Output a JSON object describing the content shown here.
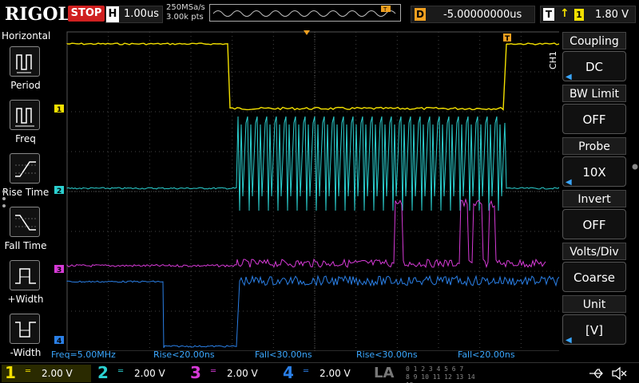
{
  "brand": "RIGOL",
  "run_state": "STOP",
  "timebase": {
    "tag": "H",
    "value": "1.00us"
  },
  "sample": {
    "rate": "250MSa/s",
    "points": "3.00k pts"
  },
  "delay": {
    "tag": "D",
    "value": "-5.00000000us"
  },
  "trigger": {
    "tag": "T",
    "edge": "rising",
    "source": "1",
    "level": "1.80 V"
  },
  "horizontal_menu": {
    "title": "Horizontal",
    "items": [
      "Period",
      "Freq",
      "Rise Time",
      "Fall Time",
      "+Width",
      "-Width"
    ]
  },
  "ch1_menu": {
    "side_label": "CH1",
    "items": [
      {
        "title": "Coupling",
        "value": "DC"
      },
      {
        "title": "BW Limit",
        "value": "OFF"
      },
      {
        "title": "Probe",
        "value": "10X"
      },
      {
        "title": "Invert",
        "value": "OFF"
      },
      {
        "title": "Volts/Div",
        "value": "Coarse"
      },
      {
        "title": "Unit",
        "value": "[V]"
      }
    ]
  },
  "measurements": [
    "Freq=5.00MHz",
    "Rise<20.00ns",
    "Fall<30.00ns",
    "Rise<30.00ns",
    "Fall<20.00ns"
  ],
  "channels": [
    {
      "num": "1",
      "value": "2.00 V",
      "color": "#f3e000"
    },
    {
      "num": "2",
      "value": "2.00 V",
      "color": "#2bd0d0"
    },
    {
      "num": "3",
      "value": "2.00 V",
      "color": "#d63ad6"
    },
    {
      "num": "4",
      "value": "2.00 V",
      "color": "#2a7fe6"
    }
  ],
  "la": {
    "label": "LA",
    "row1": "0 1 2 3  4 5 6 7",
    "row2": "8 9 10 11 12 13 14 15"
  },
  "markers": {
    "ch1": "1",
    "ch2": "2",
    "ch3": "3",
    "ch4": "4",
    "trigger": "T"
  }
}
